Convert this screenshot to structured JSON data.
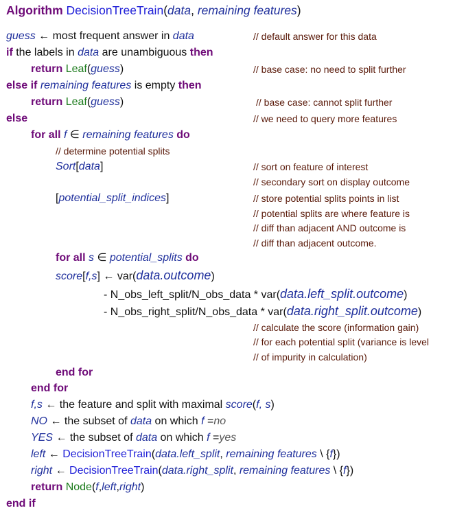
{
  "algorithm": {
    "keyword": "Algorithm",
    "name": "DecisionTreeTrain",
    "open": "(",
    "arg1": "data",
    "sep": ", ",
    "arg2": "remaining features",
    "close": ")"
  },
  "lines": {
    "l1": {
      "var": "guess",
      "text": " ← most frequent answer in ",
      "var2": "data",
      "comment": "// default answer for this data"
    },
    "l2": {
      "kw": "if",
      "text": " the labels in ",
      "var": "data",
      "text2": " are unambiguous ",
      "kw2": "then"
    },
    "l3": {
      "kw": "return",
      "sp": " ",
      "cls": "Leaf",
      "open": "(",
      "var": "guess",
      "close": ")",
      "comment": "// base case: no need to split further"
    },
    "l4": {
      "kw": "else if",
      "sp": " ",
      "var": "remaining features",
      "text": " is empty ",
      "kw2": "then"
    },
    "l5": {
      "kw": "return",
      "sp": " ",
      "cls": "Leaf",
      "open": "(",
      "var": "guess",
      "close": ")",
      "comment": "// base case: cannot split further"
    },
    "l6": {
      "kw": "else",
      "comment": "// we need to query more features"
    },
    "l7": {
      "kw": "for all",
      "sp": " ",
      "var": "f",
      "elem": " ∈ ",
      "var2": "remaining features",
      "sp2": " ",
      "kw2": "do"
    },
    "l8": {
      "comment": "// determine potential splits"
    },
    "l9": {
      "var": "Sort",
      "open": "[",
      "var2": "data",
      "close": "]",
      "comment": "// sort on feature of interest",
      "comment2": "// secondary sort on display outcome"
    },
    "l10": {
      "open": "[",
      "var": "potential_split_indices",
      "close": "]",
      "comment": "// store potential splits points in list",
      "comment2": "// potential splits are where feature is",
      "comment3": "// diff than adjacent AND outcome is",
      "comment4": "// diff than adjacent outcome."
    },
    "l11": {
      "kw": "for all",
      "sp": " ",
      "var": "s",
      "elem": " ∈ ",
      "var2": "potential_splits",
      "sp2": " ",
      "kw2": "do"
    },
    "l12": {
      "var": "score",
      "open": "[",
      "var2": "f,s",
      "close": "]",
      "text": " ← var(",
      "var3": "data.outcome",
      "close2": ")"
    },
    "l13": {
      "text": "- N_obs_left_split/N_obs_data * var(",
      "var": "data.left_split.outcome",
      "close": ")"
    },
    "l14": {
      "text": "- N_obs_right_split/N_obs_data * var(",
      "var": "data.right_split.outcome",
      "close": ")",
      "comment": "// calculate the score (information gain)",
      "comment2": "// for each potential split (variance is level",
      "comment3": "// of impurity in calculation)"
    },
    "l15": {
      "kw": "end for"
    },
    "l16": {
      "kw": "end for"
    },
    "l17": {
      "var": "f,s",
      "text": " ← the feature and split with maximal ",
      "var2": "score",
      "open": "(",
      "var3": "f, s",
      "close": ")"
    },
    "l18": {
      "var": "NO",
      "text": " ← the subset of ",
      "var2": "data",
      "text2": " on which ",
      "var3": "f",
      "text3": " =",
      "lit": "no"
    },
    "l19": {
      "var": "YES",
      "text": " ← the subset of ",
      "var2": "data",
      "text2": " on which ",
      "var3": "f",
      "text3": " =",
      "lit": "yes"
    },
    "l20": {
      "var": "left",
      "text": " ← ",
      "fn": "DecisionTreeTrain",
      "open": "(",
      "var2": "data.left_split",
      "sep": ", ",
      "var3": "remaining features",
      "text2": " \\ {",
      "var4": "f",
      "close": "})"
    },
    "l21": {
      "var": "right",
      "text": " ← ",
      "fn": "DecisionTreeTrain",
      "open": "(",
      "var2": "data.right_split",
      "sep": ", ",
      "var3": "remaining features",
      "text2": " \\ {",
      "var4": "f",
      "close": "})"
    },
    "l22": {
      "kw": "return",
      "sp": " ",
      "cls": "Node",
      "open": "(",
      "var": "f",
      "c1": ",",
      "var2": "left",
      "c2": ",",
      "var3": "right",
      "close": ")"
    },
    "l23": {
      "kw": "end if"
    }
  },
  "colors": {
    "keyword": "#6e0a78",
    "variable": "#1f2f9c",
    "function": "#2020d8",
    "constructor": "#1a7a1a",
    "comment": "#5a1a0a"
  }
}
